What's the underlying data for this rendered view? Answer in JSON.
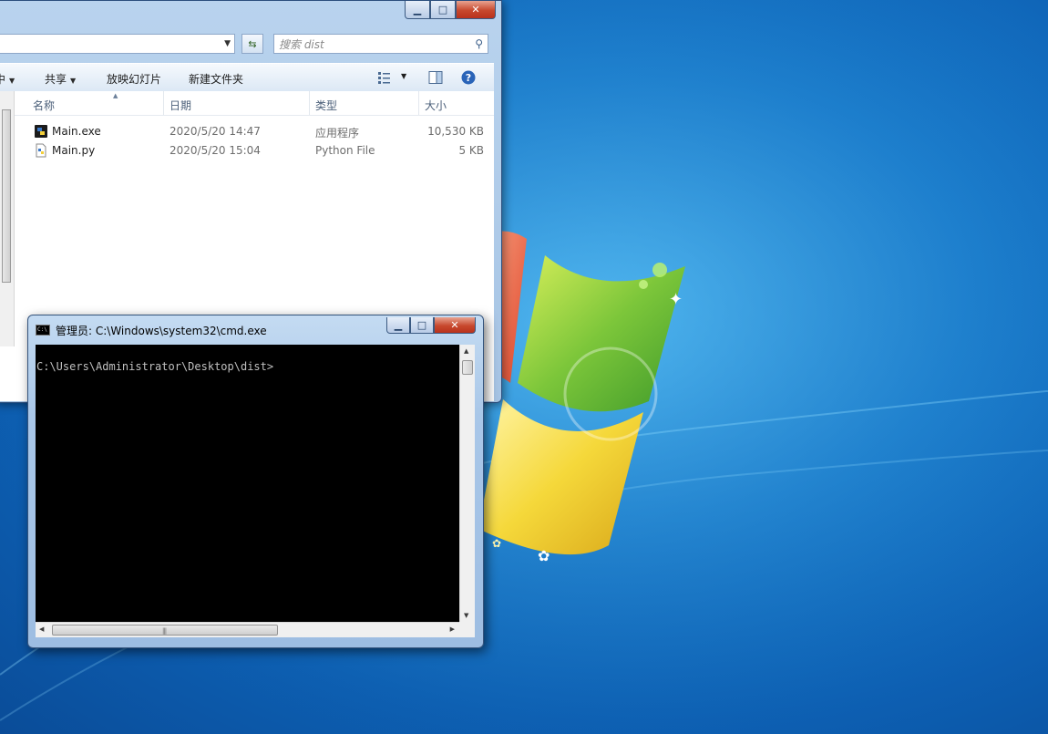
{
  "explorer": {
    "search_placeholder": "搜索 dist",
    "toolbar": {
      "organize_partial": "中",
      "share": "共享",
      "slideshow": "放映幻灯片",
      "new_folder": "新建文件夹"
    },
    "columns": {
      "name": "名称",
      "date": "日期",
      "type": "类型",
      "size": "大小"
    },
    "files": [
      {
        "name": "Main.exe",
        "date": "2020/5/20 14:47",
        "type": "应用程序",
        "size": "10,530 KB",
        "icon": "exe-icon"
      },
      {
        "name": "Main.py",
        "date": "2020/5/20 15:04",
        "type": "Python File",
        "size": "5 KB",
        "icon": "python-file-icon"
      }
    ]
  },
  "cmd": {
    "title": "管理员: C:\\Windows\\system32\\cmd.exe",
    "icon_text": "C:\\",
    "prompt": "C:\\Users\\Administrator\\Desktop\\dist>"
  },
  "colors": {
    "desktop_blue": "#1a7fd0",
    "console_bg": "#000000",
    "console_text": "#c0c0c0",
    "close_red": "#c7482d"
  }
}
